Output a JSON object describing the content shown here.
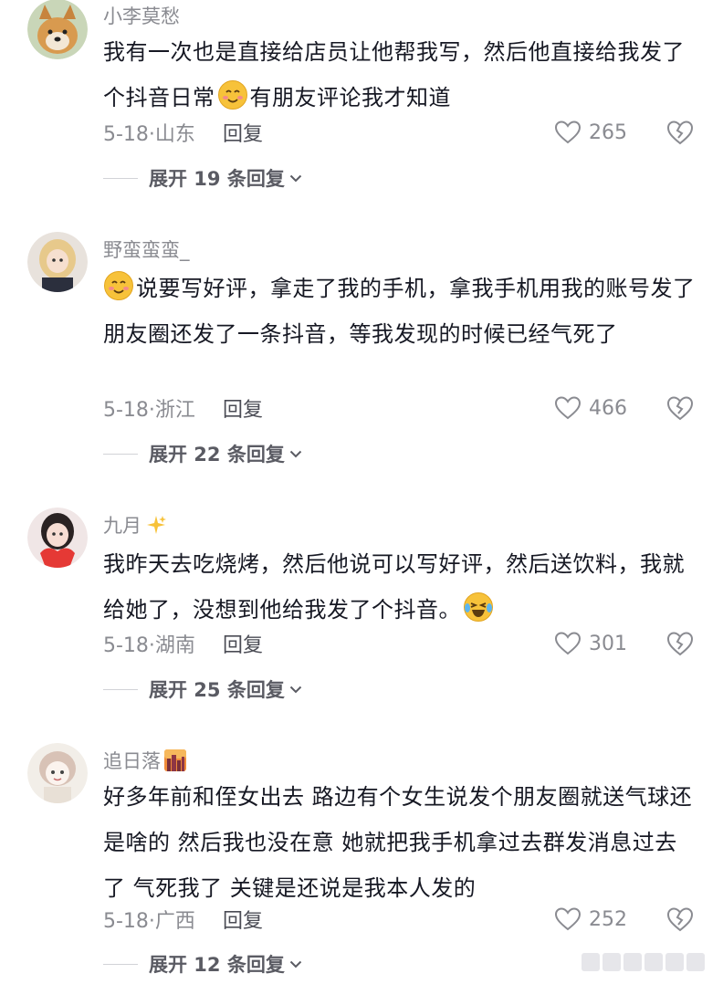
{
  "comments": [
    {
      "username": "小李莫愁",
      "text_before": "我有一次也是直接给店员让他帮我写，然后他直接给我发了个抖音日常",
      "text_after": "有朋友评论我才知道",
      "emoji": "blush-smile-emoji",
      "date": "5-18·山东",
      "reply_label": "回复",
      "likes": "265",
      "expand_label": "展开 19 条回复"
    },
    {
      "username": "野蛮蛮蛮_",
      "text_before": "",
      "text_after": "说要写好评，拿走了我的手机，拿我手机用我的账号发了朋友圈还发了一条抖音，等我发现的时候已经气死了",
      "emoji": "blush-smile-emoji",
      "date": "5-18·浙江",
      "reply_label": "回复",
      "likes": "466",
      "expand_label": "展开 22 条回复"
    },
    {
      "username": "九月",
      "username_deco": "sparkles-emoji",
      "text_before": "我昨天去吃烧烤，然后他说可以写好评，然后送饮料，我就给她了，没想到他给我发了个抖音。",
      "text_after": "",
      "emoji": "crying-laughing-emoji",
      "date": "5-18·湖南",
      "reply_label": "回复",
      "likes": "301",
      "expand_label": "展开 25 条回复"
    },
    {
      "username": "追日落",
      "username_deco": "city-sunset-emoji",
      "text_before": "好多年前和侄女出去 路边有个女生说发个朋友圈就送气球还是啥的 然后我也没在意 她就把我手机拿过去群发消息过去了 气死我了 关键是还说是我本人发的",
      "text_after": "",
      "emoji": "",
      "date": "5-18·广西",
      "reply_label": "回复",
      "likes": "252",
      "expand_label": "展开 12 条回复"
    }
  ],
  "colors": {
    "secondary": "#8a8b91",
    "primary_text": "#161823",
    "emoji_yellow": "#f7c23a"
  },
  "icons": {
    "like": "heart-outline-icon",
    "dislike": "broken-heart-icon",
    "expand": "chevron-down-icon"
  }
}
